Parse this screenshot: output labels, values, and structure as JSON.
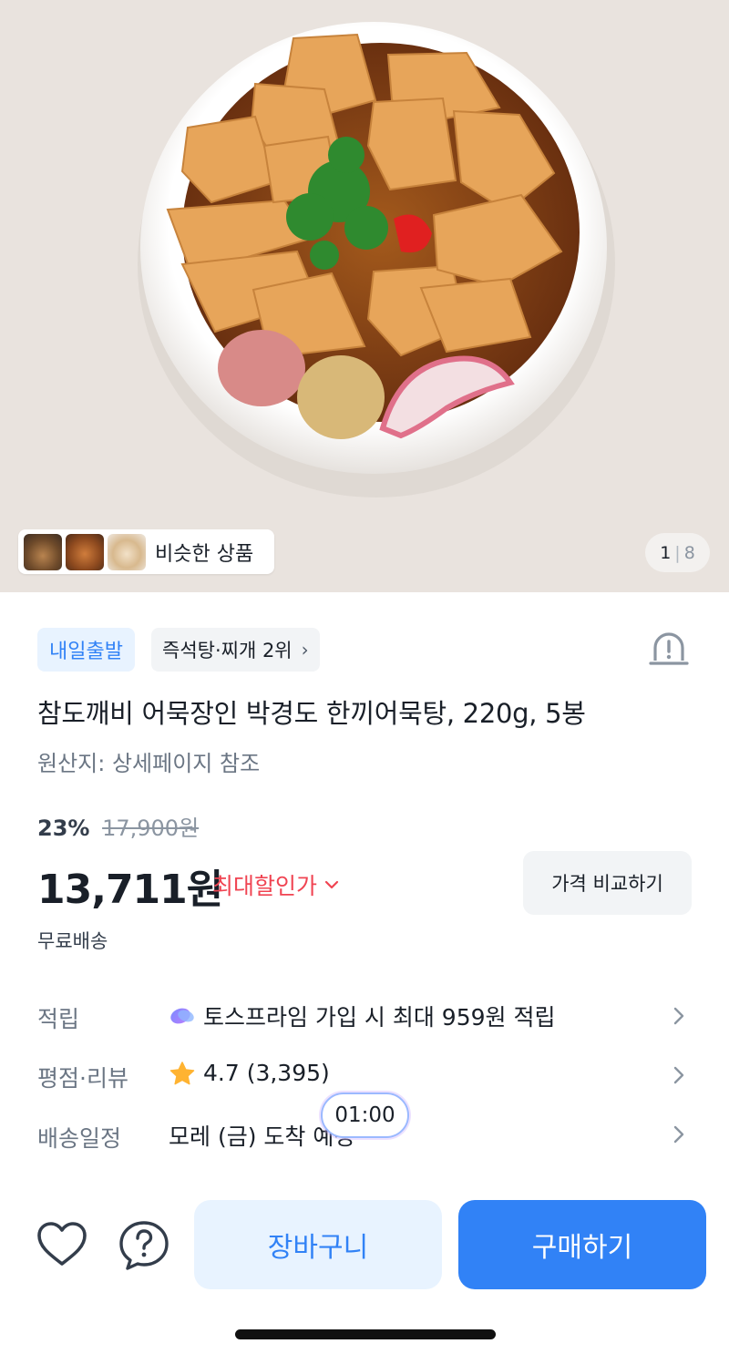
{
  "hero": {
    "similar_label": "비슷한 상품",
    "page_current": "1",
    "page_separator": "|",
    "page_total": "8"
  },
  "tags": {
    "delivery_badge": "내일출발",
    "ranking": "즉석탕·찌개 2위",
    "ranking_chevron": "›"
  },
  "product": {
    "title": "참도깨비 어묵장인 박경도 한끼어묵탕, 220g, 5봉",
    "origin": "원산지: 상세페이지 참조"
  },
  "price": {
    "discount_rate": "23%",
    "original_price": "17,900원",
    "sale_price": "13,711원",
    "max_discount_label": "최대할인가",
    "compare_button": "가격 비교하기",
    "shipping": "무료배송"
  },
  "info": {
    "points_label": "적립",
    "points_value": "토스프라임 가입 시 최대 959원 적립",
    "rating_label": "평점·리뷰",
    "rating_value": "4.7 (3,395)",
    "delivery_label": "배송일정",
    "delivery_value": "모레 (금) 도착 예정"
  },
  "overlay": {
    "timer": "01:00"
  },
  "bottom": {
    "cart_button": "장바구니",
    "buy_button": "구매하기"
  },
  "colors": {
    "accent_blue": "#3182f6",
    "discount_red": "#f04452",
    "star_yellow": "#ffb331"
  },
  "icons": [
    "alert-icon",
    "chevron-right-icon",
    "chevron-down-icon",
    "prime-icon",
    "star-icon",
    "heart-icon",
    "question-icon"
  ]
}
